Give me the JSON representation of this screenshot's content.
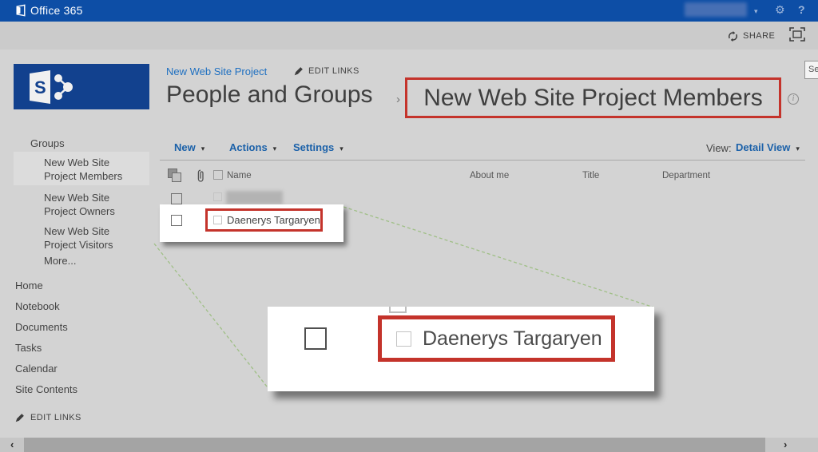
{
  "suite_bar": {
    "brand": "Office 365",
    "caret": "▾",
    "gear": "⚙",
    "help": "?"
  },
  "ribbon": {
    "share": "SHARE"
  },
  "header": {
    "breadcrumb_site": "New Web Site Project",
    "edit_links": "EDIT LINKS",
    "title_section": "People and Groups",
    "title_separator": "›",
    "title_current": "New Web Site Project Members",
    "info": "i",
    "search_partial": "Se"
  },
  "toolbar": {
    "menus": [
      {
        "label": "New"
      },
      {
        "label": "Actions"
      },
      {
        "label": "Settings"
      }
    ],
    "caret": "▾",
    "view_label": "View:",
    "view_value": "Detail View"
  },
  "sidebar": {
    "groups_heading": "Groups",
    "group_items": [
      {
        "label": "New Web Site Project Members",
        "selected": true
      },
      {
        "label": "New Web Site Project Owners",
        "selected": false
      },
      {
        "label": "New Web Site Project Visitors",
        "selected": false
      },
      {
        "label": "More...",
        "selected": false
      }
    ],
    "nav_items": [
      {
        "label": "Home"
      },
      {
        "label": "Notebook"
      },
      {
        "label": "Documents"
      },
      {
        "label": "Tasks"
      },
      {
        "label": "Calendar"
      },
      {
        "label": "Site Contents"
      }
    ],
    "edit_links": "EDIT LINKS"
  },
  "table": {
    "columns": [
      "Name",
      "About me",
      "Title",
      "Department"
    ],
    "rows": [
      {
        "name": "",
        "redacted": true
      },
      {
        "name": "Daenerys Targaryen",
        "redacted": false,
        "highlighted": true
      }
    ]
  },
  "callout": {
    "name": "Daenerys Targaryen"
  },
  "scrollbar": {
    "left_arrow": "‹",
    "right_arrow": "›"
  },
  "colors": {
    "suite_blue": "#0d4ea6",
    "logo_blue": "#12418e",
    "link_blue": "#1b61a9",
    "annotation_red": "#c4332b",
    "connector_green": "#9fbf86",
    "page_gray": "#d3d3d3"
  }
}
